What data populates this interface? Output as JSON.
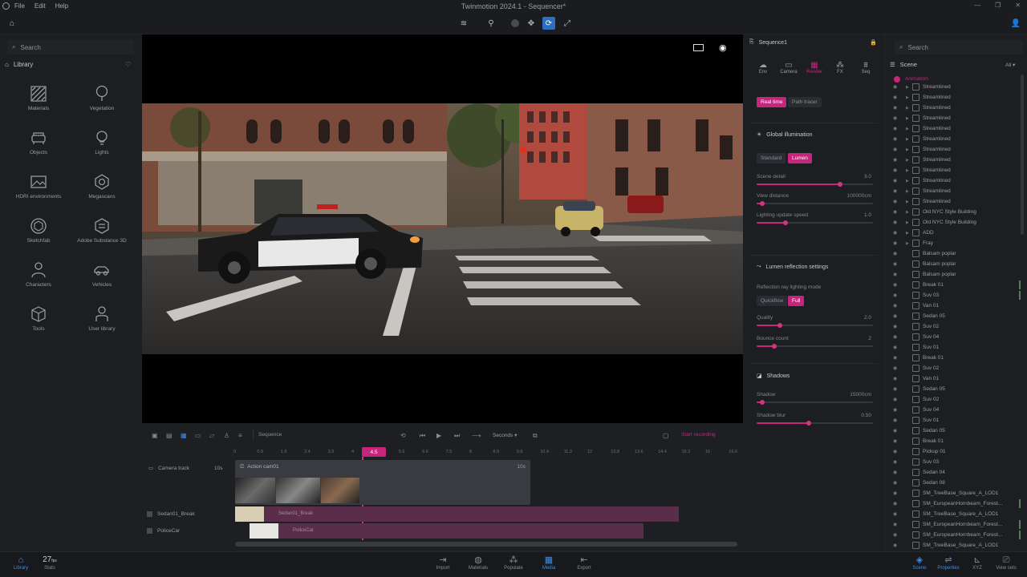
{
  "app": {
    "title": "Twinmotion 2024.1 - Sequencer*",
    "menu": [
      "File",
      "Edit",
      "Help"
    ]
  },
  "left_panel": {
    "search_placeholder": "Search",
    "section_title": "Library",
    "items": [
      {
        "label": "Materials",
        "icon": "materials-icon"
      },
      {
        "label": "Vegetation",
        "icon": "tree-icon"
      },
      {
        "label": "Objects",
        "icon": "sofa-icon"
      },
      {
        "label": "Lights",
        "icon": "bulb-icon"
      },
      {
        "label": "HDRI environments",
        "icon": "image-icon"
      },
      {
        "label": "Megascans",
        "icon": "megascans-icon"
      },
      {
        "label": "Sketchfab",
        "icon": "sketchfab-icon"
      },
      {
        "label": "Adobe Substance 3D",
        "icon": "substance-icon"
      },
      {
        "label": "Characters",
        "icon": "person-icon"
      },
      {
        "label": "Vehicles",
        "icon": "car-icon"
      },
      {
        "label": "Tools",
        "icon": "cube-icon"
      },
      {
        "label": "User library",
        "icon": "user-icon"
      }
    ]
  },
  "sequencer": {
    "dropdown_label": "Sequence",
    "time_unit": "Seconds",
    "record_label": "Start recording",
    "playhead_time": "4.5",
    "ruler": [
      "0",
      "0.9",
      "1.8",
      "2.4",
      "3.3",
      "4",
      "4.5",
      "5.6",
      "6.6",
      "7.5",
      "8",
      "8.9",
      "9.6",
      "10.4",
      "11.3",
      "12",
      "12.8",
      "13.6",
      "14.4",
      "15.2",
      "16",
      "16.6"
    ],
    "tracks": {
      "camera_track": "Camera track",
      "camera_track_duration": "10s",
      "clip_label": "Action cam01",
      "clip_duration": "10s",
      "track2": "Sedan01_Break",
      "track2_clip": "Sedan01_Break",
      "track3": "PoliceCar",
      "track3_clip": "PoliceCar"
    }
  },
  "props_panel": {
    "title": "Sequence1",
    "tabs": [
      "Env",
      "Camera",
      "Render",
      "FX",
      "Seq"
    ],
    "render_mode": {
      "real_time": "Real time",
      "path_tracer": "Path tracer"
    },
    "gi": {
      "title": "Global illumination",
      "standard": "Standard",
      "lumen": "Lumen",
      "sliders": [
        {
          "label": "Scene detail",
          "value": "3.0",
          "fraction": 0.72
        },
        {
          "label": "View distance",
          "value": "100000cm",
          "fraction": 0.05
        },
        {
          "label": "Lighting update speed",
          "value": "1.0",
          "fraction": 0.25
        }
      ]
    },
    "reflection": {
      "title": "Lumen reflection settings",
      "mode_label": "Reflection ray lighting mode",
      "opt1": "Quickflow",
      "opt2": "Full",
      "sliders": [
        {
          "label": "Quality",
          "value": "2.0",
          "fraction": 0.2
        },
        {
          "label": "Bounce count",
          "value": "2",
          "fraction": 0.15
        }
      ]
    },
    "shadows": {
      "title": "Shadows",
      "sliders": [
        {
          "label": "Shadow",
          "value": "15000cm",
          "fraction": 0.05
        },
        {
          "label": "Shadow blur",
          "value": "0.50",
          "fraction": 0.45
        }
      ]
    }
  },
  "scene_panel": {
    "search_placeholder": "Search",
    "title": "Scene",
    "filter": "All",
    "selected": "Animation",
    "items": [
      {
        "label": "Streamlined",
        "type": "folder"
      },
      {
        "label": "Streamlined",
        "type": "folder"
      },
      {
        "label": "Streamlined",
        "type": "folder"
      },
      {
        "label": "Streamlined",
        "type": "folder"
      },
      {
        "label": "Streamlined",
        "type": "folder"
      },
      {
        "label": "Streamlined",
        "type": "folder"
      },
      {
        "label": "Streamlined",
        "type": "folder"
      },
      {
        "label": "Streamlined",
        "type": "folder"
      },
      {
        "label": "Streamlined",
        "type": "folder"
      },
      {
        "label": "Streamlined",
        "type": "folder"
      },
      {
        "label": "Streamlined",
        "type": "folder"
      },
      {
        "label": "Streamlined",
        "type": "folder"
      },
      {
        "label": "Old NYC Style Building",
        "type": "folder"
      },
      {
        "label": "Old NYC Style Building",
        "type": "folder"
      },
      {
        "label": "ADD",
        "type": "folder"
      },
      {
        "label": "Fray",
        "type": "folder"
      },
      {
        "label": "Balsam poplar",
        "type": "item"
      },
      {
        "label": "Balsam poplar",
        "type": "item"
      },
      {
        "label": "Balsam poplar",
        "type": "item"
      },
      {
        "label": "Break 01",
        "type": "item",
        "mark": true
      },
      {
        "label": "Suv 03",
        "type": "item",
        "mark": true
      },
      {
        "label": "Van 01",
        "type": "item"
      },
      {
        "label": "Sedan 05",
        "type": "item"
      },
      {
        "label": "Suv 02",
        "type": "item"
      },
      {
        "label": "Suv 04",
        "type": "item"
      },
      {
        "label": "Suv 01",
        "type": "item"
      },
      {
        "label": "Break 01",
        "type": "item"
      },
      {
        "label": "Suv 02",
        "type": "item"
      },
      {
        "label": "Van 01",
        "type": "item"
      },
      {
        "label": "Sedan 05",
        "type": "item"
      },
      {
        "label": "Suv 02",
        "type": "item"
      },
      {
        "label": "Suv 04",
        "type": "item"
      },
      {
        "label": "Suv 01",
        "type": "item"
      },
      {
        "label": "Sedan 05",
        "type": "item"
      },
      {
        "label": "Break 01",
        "type": "item"
      },
      {
        "label": "Pickup 01",
        "type": "item"
      },
      {
        "label": "Suv 03",
        "type": "item"
      },
      {
        "label": "Sedan 04",
        "type": "item"
      },
      {
        "label": "Sedan 08",
        "type": "item"
      },
      {
        "label": "SM_TreeBase_Square_A_LOD1",
        "type": "item"
      },
      {
        "label": "SM_EuropeanHornbeam_Forest...",
        "type": "item",
        "mark": true
      },
      {
        "label": "SM_TreeBase_Square_A_LOD1",
        "type": "item"
      },
      {
        "label": "SM_EuropeanHornbeam_Forest...",
        "type": "item",
        "mark": true
      },
      {
        "label": "SM_EuropeanHornbeam_Forest...",
        "type": "item",
        "mark": true
      },
      {
        "label": "SM_TreeBase_Square_A_LOD1",
        "type": "item"
      }
    ]
  },
  "bottom_bar": {
    "library": "Library",
    "fps": "27",
    "fps_unit": "fps",
    "stats": "Stats",
    "center": [
      "Import",
      "Materials",
      "Populate",
      "Media",
      "Export"
    ],
    "right": [
      "Scene",
      "Properties",
      "XYZ",
      "View sets"
    ]
  },
  "colors": {
    "accent": "#c5257a",
    "blue": "#3d8ee6"
  }
}
